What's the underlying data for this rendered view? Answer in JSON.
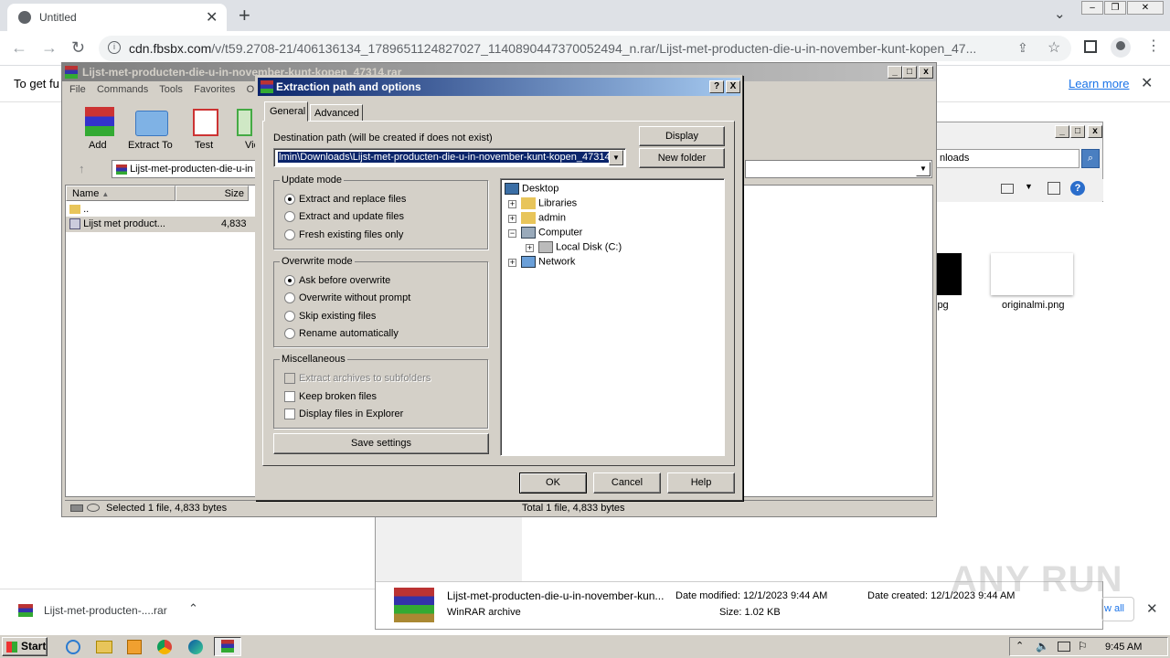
{
  "browser": {
    "tab_title": "Untitled",
    "url_domain": "cdn.fbsbx.com",
    "url_path": "/v/t59.2708-21/406136134_1789651124827027_1140890447370052494_n.rar/Lijst-met-producten-die-u-in-november-kunt-kopen_47...",
    "infobar_text": "To get fu",
    "learn_more": "Learn more",
    "download_item": "Lijst-met-producten-....rar"
  },
  "winrar": {
    "title": "Lijst-met-producten-die-u-in-november-kunt-kopen_47314.rar",
    "menu": [
      "File",
      "Commands",
      "Tools",
      "Favorites",
      "Opt"
    ],
    "toolbar": [
      "Add",
      "Extract To",
      "Test",
      "Vie"
    ],
    "path_text": "Lijst-met-producten-die-u-in",
    "col_name": "Name",
    "col_size": "Size",
    "rows": [
      {
        "name": "..",
        "size": ""
      },
      {
        "name": "Lijst met product...",
        "size": "4,833"
      }
    ],
    "status_left": "Selected 1 file, 4,833 bytes",
    "status_right": "Total 1 file, 4,833 bytes"
  },
  "dialog": {
    "title": "Extraction path and options",
    "help_btn": "?",
    "close_btn": "X",
    "tabs": [
      "General",
      "Advanced"
    ],
    "dest_label": "Destination path (will be created if does not exist)",
    "dest_value": "lmin\\Downloads\\Lijst-met-producten-die-u-in-november-kunt-kopen_47314",
    "display_btn": "Display",
    "new_folder_btn": "New folder",
    "update_mode": {
      "label": "Update mode",
      "options": [
        "Extract and replace files",
        "Extract and update files",
        "Fresh existing files only"
      ],
      "selected": 0
    },
    "overwrite_mode": {
      "label": "Overwrite mode",
      "options": [
        "Ask before overwrite",
        "Overwrite without prompt",
        "Skip existing files",
        "Rename automatically"
      ],
      "selected": 0
    },
    "misc": {
      "label": "Miscellaneous",
      "options": [
        "Extract archives to subfolders",
        "Keep broken files",
        "Display files in Explorer"
      ]
    },
    "save_settings": "Save settings",
    "tree": [
      "Desktop",
      "Libraries",
      "admin",
      "Computer",
      "Local Disk (C:)",
      "Network"
    ],
    "ok": "OK",
    "cancel": "Cancel",
    "help": "Help"
  },
  "explorer": {
    "search_text": "nloads",
    "thumb1_label": "jpg",
    "thumb2_label": "originalmi.png",
    "file_name": "Lijst-met-producten-die-u-in-november-kun...",
    "file_type": "WinRAR archive",
    "date_modified": "Date modified: 12/1/2023 9:44 AM",
    "date_created": "Date created: 12/1/2023 9:44 AM",
    "size": "Size: 1.02 KB",
    "show_all": "w all"
  },
  "taskbar": {
    "start": "Start",
    "clock": "9:45 AM"
  },
  "watermark": "ANY RUN"
}
